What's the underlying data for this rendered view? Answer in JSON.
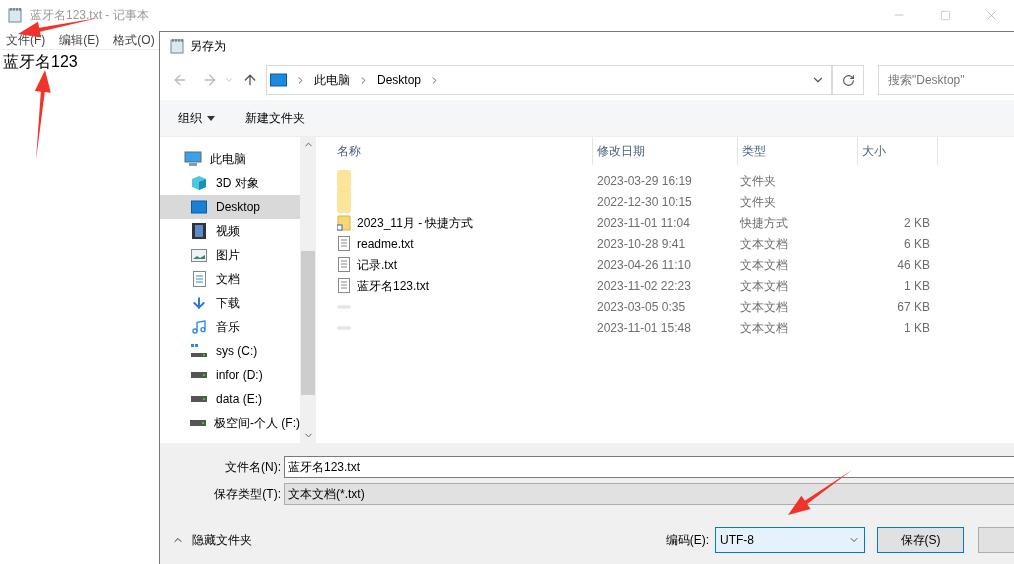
{
  "notepad": {
    "title": "蓝牙名123.txt - 记事本",
    "menu": [
      "文件(F)",
      "编辑(E)",
      "格式(O)"
    ],
    "content": "蓝牙名123"
  },
  "dialog": {
    "title": "另存为",
    "breadcrumb": [
      "此电脑",
      "Desktop"
    ],
    "search": {
      "placeholder": "搜索\"Desktop\""
    },
    "toolbar": {
      "organize": "组织",
      "new_folder": "新建文件夹"
    },
    "nav": [
      {
        "label": "此电脑",
        "kind": "pc",
        "selected": false,
        "children": [
          {
            "label": "3D 对象",
            "kind": "cube",
            "selected": false
          },
          {
            "label": "Desktop",
            "kind": "desktop",
            "selected": true
          },
          {
            "label": "视频",
            "kind": "video",
            "selected": false
          },
          {
            "label": "图片",
            "kind": "image",
            "selected": false
          },
          {
            "label": "文档",
            "kind": "doc",
            "selected": false
          },
          {
            "label": "下载",
            "kind": "download",
            "selected": false
          },
          {
            "label": "音乐",
            "kind": "music",
            "selected": false
          },
          {
            "label": "sys (C:)",
            "kind": "sysdrive",
            "selected": false
          },
          {
            "label": "infor (D:)",
            "kind": "drive",
            "selected": false
          },
          {
            "label": "data (E:)",
            "kind": "drive",
            "selected": false
          },
          {
            "label": "极空间-个人 (F:)",
            "kind": "drive",
            "selected": false
          }
        ]
      }
    ],
    "columns": [
      "名称",
      "修改日期",
      "类型",
      "大小"
    ],
    "files": [
      {
        "kind": "folder",
        "date": "2023-03-29 16:19",
        "type": "文件夹"
      },
      {
        "kind": "folder",
        "date": "2022-12-30 10:15",
        "type": "文件夹"
      },
      {
        "kind": "shortcut",
        "name": "2023_11月 - 快捷方式",
        "date": "2023-11-01 11:04",
        "type": "快捷方式",
        "size": "2 KB"
      },
      {
        "kind": "text",
        "name": "readme.txt",
        "date": "2023-10-28 9:41",
        "type": "文本文档",
        "size": "6 KB"
      },
      {
        "kind": "text",
        "name": "记录.txt",
        "date": "2023-04-26 11:10",
        "type": "文本文档",
        "size": "46 KB"
      },
      {
        "kind": "text",
        "name": "蓝牙名123.txt",
        "date": "2023-11-02 22:23",
        "type": "文本文档",
        "size": "1 KB"
      },
      {
        "kind": "blurred",
        "date": "2023-03-05 0:35",
        "type": "文本文档",
        "size": "67 KB"
      },
      {
        "kind": "blurred",
        "date": "2023-11-01 15:48",
        "type": "文本文档",
        "size": "1 KB"
      }
    ],
    "filename": {
      "label": "文件名(N):",
      "value": "蓝牙名123.txt"
    },
    "filetype": {
      "label": "保存类型(T):",
      "value": "文本文档(*.txt)"
    },
    "hide_folders": "隐藏文件夹",
    "encoding": {
      "label": "编码(E):",
      "value": "UTF-8"
    },
    "save": "保存(S)"
  }
}
